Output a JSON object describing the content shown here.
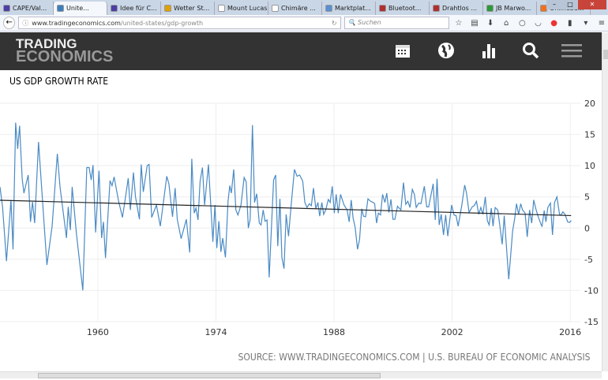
{
  "browser": {
    "tabs": [
      {
        "label": "CAPE/Val...",
        "color": "#4b3fa6"
      },
      {
        "label": "Unite...",
        "color": "#3a7fc0",
        "active": true
      },
      {
        "label": "Idee für C...",
        "color": "#4b3fa6"
      },
      {
        "label": "Wetter St...",
        "color": "#e0a000"
      },
      {
        "label": "Mount Lucas ...",
        "color": "#ffffff"
      },
      {
        "label": "Chimäre ...",
        "color": "#ffffff"
      },
      {
        "label": "Marktplat...",
        "color": "#5a8fd0"
      },
      {
        "label": "Bluetoot...",
        "color": "#b03030"
      },
      {
        "label": "Drahtlos ...",
        "color": "#b03030"
      },
      {
        "label": "JB Marwo...",
        "color": "#2a9a3a"
      },
      {
        "label": "Onlineba...",
        "color": "#f07020"
      }
    ],
    "url_domain": "www.tradingeconomics.com",
    "url_path": "/united-states/gdp-growth",
    "search_placeholder": "Suchen"
  },
  "header": {
    "logo_line1": "TRADING",
    "logo_line2": "ECONOMICS"
  },
  "page_title": "US GDP GROWTH RATE",
  "source": "SOURCE: WWW.TRADINGECONOMICS.COM | U.S. BUREAU OF ECONOMIC ANALYSIS",
  "chart_data": {
    "type": "line",
    "title": "US GDP GROWTH RATE",
    "xlabel": "",
    "ylabel": "",
    "xlim": [
      1948.4,
      2017.2
    ],
    "ylim": [
      -15,
      20
    ],
    "yticks": [
      20,
      15,
      10,
      5,
      0,
      -5,
      -10,
      -15
    ],
    "xticks": [
      1960,
      1974,
      1988,
      2002,
      2016
    ],
    "grid": true,
    "line_color": "#4a8ac4",
    "trend": {
      "x": [
        1948.4,
        2016.1
      ],
      "y": [
        4.46,
        2.0
      ],
      "color": "#222222"
    },
    "series": [
      {
        "name": "GDP Growth Rate",
        "points": [
          [
            1948.4,
            6.6
          ],
          [
            1948.71,
            3.3
          ],
          [
            1949.17,
            -5.3
          ],
          [
            1949.7,
            4.5
          ],
          [
            1949.94,
            -3.4
          ],
          [
            1950.25,
            16.9
          ],
          [
            1950.5,
            12.7
          ],
          [
            1950.72,
            16.4
          ],
          [
            1951.03,
            7.9
          ],
          [
            1951.24,
            5.6
          ],
          [
            1951.74,
            8.5
          ],
          [
            1952.01,
            1.0
          ],
          [
            1952.26,
            4.2
          ],
          [
            1952.51,
            0.8
          ],
          [
            1952.97,
            13.8
          ],
          [
            1953.96,
            -5.9
          ],
          [
            1954.58,
            0.3
          ],
          [
            1955.2,
            11.9
          ],
          [
            1955.51,
            6.6
          ],
          [
            1956.28,
            -1.6
          ],
          [
            1956.49,
            3.4
          ],
          [
            1956.74,
            -0.3
          ],
          [
            1956.96,
            6.6
          ],
          [
            1957.45,
            -0.8
          ],
          [
            1958.22,
            -10.0
          ],
          [
            1958.69,
            9.7
          ],
          [
            1958.97,
            9.7
          ],
          [
            1959.21,
            7.7
          ],
          [
            1959.43,
            10.1
          ],
          [
            1959.74,
            -0.7
          ],
          [
            1960.14,
            9.2
          ],
          [
            1960.45,
            -1.6
          ],
          [
            1960.66,
            1.0
          ],
          [
            1960.91,
            -4.8
          ],
          [
            1961.44,
            7.6
          ],
          [
            1961.68,
            6.8
          ],
          [
            1961.93,
            8.2
          ],
          [
            1962.46,
            4.3
          ],
          [
            1962.92,
            1.7
          ],
          [
            1963.23,
            4.5
          ],
          [
            1963.6,
            8.0
          ],
          [
            1963.85,
            2.9
          ],
          [
            1964.22,
            8.9
          ],
          [
            1964.46,
            5.0
          ],
          [
            1964.93,
            1.4
          ],
          [
            1965.14,
            10.2
          ],
          [
            1965.39,
            5.8
          ],
          [
            1965.85,
            10.0
          ],
          [
            1966.07,
            10.2
          ],
          [
            1966.38,
            1.7
          ],
          [
            1966.94,
            3.7
          ],
          [
            1967.4,
            0.3
          ],
          [
            1967.71,
            3.5
          ],
          [
            1968.17,
            8.3
          ],
          [
            1968.42,
            7.1
          ],
          [
            1968.85,
            1.8
          ],
          [
            1969.16,
            6.4
          ],
          [
            1969.41,
            1.4
          ],
          [
            1969.87,
            -1.7
          ],
          [
            1970.49,
            1.4
          ],
          [
            1970.89,
            -3.9
          ],
          [
            1971.14,
            11.1
          ],
          [
            1971.42,
            2.4
          ],
          [
            1971.63,
            3.2
          ],
          [
            1971.88,
            1.3
          ],
          [
            1972.12,
            7.5
          ],
          [
            1972.4,
            9.7
          ],
          [
            1972.65,
            3.7
          ],
          [
            1973.11,
            10.2
          ],
          [
            1973.64,
            -2.2
          ],
          [
            1973.88,
            3.7
          ],
          [
            1974.1,
            -3.2
          ],
          [
            1974.35,
            1.1
          ],
          [
            1974.59,
            -3.8
          ],
          [
            1974.81,
            -1.6
          ],
          [
            1975.12,
            -4.7
          ],
          [
            1975.43,
            4.3
          ],
          [
            1975.64,
            6.8
          ],
          [
            1975.83,
            5.6
          ],
          [
            1976.11,
            9.4
          ],
          [
            1976.36,
            2.9
          ],
          [
            1976.6,
            2.1
          ],
          [
            1976.97,
            3.7
          ],
          [
            1977.34,
            8.1
          ],
          [
            1977.59,
            7.4
          ],
          [
            1977.84,
            0.0
          ],
          [
            1978.05,
            1.4
          ],
          [
            1978.33,
            16.5
          ],
          [
            1978.58,
            4.1
          ],
          [
            1978.83,
            5.5
          ],
          [
            1979.14,
            0.8
          ],
          [
            1979.35,
            0.5
          ],
          [
            1979.6,
            2.9
          ],
          [
            1979.82,
            1.1
          ],
          [
            1980.06,
            1.3
          ],
          [
            1980.31,
            -7.9
          ],
          [
            1980.83,
            7.7
          ],
          [
            1981.08,
            8.5
          ],
          [
            1981.33,
            -2.9
          ],
          [
            1981.58,
            4.7
          ],
          [
            1981.82,
            -4.7
          ],
          [
            1982.07,
            -6.5
          ],
          [
            1982.32,
            2.2
          ],
          [
            1982.6,
            -1.3
          ],
          [
            1982.9,
            3.5
          ],
          [
            1983.31,
            9.4
          ],
          [
            1983.61,
            8.3
          ],
          [
            1983.92,
            8.5
          ],
          [
            1984.29,
            7.5
          ],
          [
            1984.54,
            4.1
          ],
          [
            1984.79,
            3.3
          ],
          [
            1985.07,
            3.9
          ],
          [
            1985.31,
            3.6
          ],
          [
            1985.56,
            6.4
          ],
          [
            1985.84,
            3.1
          ],
          [
            1986.09,
            4.1
          ],
          [
            1986.3,
            1.9
          ],
          [
            1986.55,
            4.1
          ],
          [
            1986.77,
            2.2
          ],
          [
            1987.01,
            2.9
          ],
          [
            1987.32,
            4.6
          ],
          [
            1987.54,
            4.1
          ],
          [
            1987.79,
            6.7
          ],
          [
            1988.03,
            2.4
          ],
          [
            1988.25,
            5.4
          ],
          [
            1988.5,
            2.4
          ],
          [
            1988.77,
            5.4
          ],
          [
            1989.18,
            3.7
          ],
          [
            1989.55,
            2.9
          ],
          [
            1989.79,
            1.0
          ],
          [
            1990.04,
            4.5
          ],
          [
            1990.26,
            1.6
          ],
          [
            1990.5,
            0.1
          ],
          [
            1990.78,
            -3.4
          ],
          [
            1991.03,
            -1.8
          ],
          [
            1991.28,
            3.1
          ],
          [
            1991.49,
            1.9
          ],
          [
            1991.74,
            1.8
          ],
          [
            1992.02,
            4.7
          ],
          [
            1992.33,
            4.3
          ],
          [
            1992.64,
            4.1
          ],
          [
            1992.82,
            3.9
          ],
          [
            1993.04,
            0.8
          ],
          [
            1993.26,
            2.4
          ],
          [
            1993.51,
            2.1
          ],
          [
            1993.75,
            5.4
          ],
          [
            1994.03,
            4.1
          ],
          [
            1994.25,
            5.6
          ],
          [
            1994.5,
            2.5
          ],
          [
            1994.74,
            4.6
          ],
          [
            1994.99,
            1.4
          ],
          [
            1995.21,
            1.4
          ],
          [
            1995.52,
            3.5
          ],
          [
            1995.92,
            2.9
          ],
          [
            1996.23,
            7.3
          ],
          [
            1996.5,
            3.8
          ],
          [
            1996.75,
            4.3
          ],
          [
            1997.0,
            3.3
          ],
          [
            1997.28,
            6.2
          ],
          [
            1997.52,
            5.4
          ],
          [
            1997.74,
            3.3
          ],
          [
            1998.05,
            4.0
          ],
          [
            1998.3,
            3.9
          ],
          [
            1998.7,
            6.7
          ],
          [
            1998.98,
            3.4
          ],
          [
            1999.22,
            3.4
          ],
          [
            1999.75,
            7.1
          ],
          [
            2000.0,
            1.3
          ],
          [
            2000.21,
            7.9
          ],
          [
            2000.46,
            0.5
          ],
          [
            2000.71,
            2.2
          ],
          [
            2000.98,
            -1.1
          ],
          [
            2001.23,
            2.1
          ],
          [
            2001.48,
            -1.3
          ],
          [
            2001.94,
            3.7
          ],
          [
            2002.22,
            2.1
          ],
          [
            2002.47,
            2.0
          ],
          [
            2002.71,
            0.3
          ],
          [
            2003.15,
            3.7
          ],
          [
            2003.49,
            6.9
          ],
          [
            2003.7,
            5.6
          ],
          [
            2004.01,
            2.5
          ],
          [
            2004.38,
            3.4
          ],
          [
            2004.63,
            3.6
          ],
          [
            2004.88,
            4.3
          ],
          [
            2005.15,
            2.2
          ],
          [
            2005.4,
            3.3
          ],
          [
            2005.65,
            2.2
          ],
          [
            2005.93,
            5.0
          ],
          [
            2006.17,
            1.2
          ],
          [
            2006.39,
            0.5
          ],
          [
            2006.64,
            3.2
          ],
          [
            2006.85,
            0.3
          ],
          [
            2007.1,
            3.3
          ],
          [
            2007.41,
            2.9
          ],
          [
            2007.66,
            0.3
          ],
          [
            2007.93,
            -2.6
          ],
          [
            2008.18,
            2.0
          ],
          [
            2008.71,
            -8.2
          ],
          [
            2009.17,
            -0.5
          ],
          [
            2009.42,
            1.6
          ],
          [
            2009.63,
            3.9
          ],
          [
            2009.88,
            2.2
          ],
          [
            2010.13,
            3.9
          ],
          [
            2010.34,
            2.9
          ],
          [
            2010.65,
            2.4
          ],
          [
            2010.9,
            -1.4
          ],
          [
            2011.18,
            2.9
          ],
          [
            2011.43,
            0.8
          ],
          [
            2011.67,
            4.5
          ],
          [
            2011.98,
            2.8
          ],
          [
            2012.26,
            1.6
          ],
          [
            2012.57,
            0.5
          ],
          [
            2012.66,
            0.3
          ],
          [
            2012.91,
            2.8
          ],
          [
            2013.12,
            1.0
          ],
          [
            2013.34,
            3.3
          ],
          [
            2013.65,
            4.0
          ],
          [
            2013.9,
            -1.1
          ],
          [
            2014.14,
            4.1
          ],
          [
            2014.42,
            5.0
          ],
          [
            2014.73,
            2.2
          ],
          [
            2014.92,
            2.1
          ],
          [
            2015.13,
            2.6
          ],
          [
            2015.38,
            2.2
          ],
          [
            2015.69,
            1.0
          ],
          [
            2015.91,
            0.9
          ],
          [
            2016.12,
            1.2
          ]
        ]
      }
    ]
  }
}
